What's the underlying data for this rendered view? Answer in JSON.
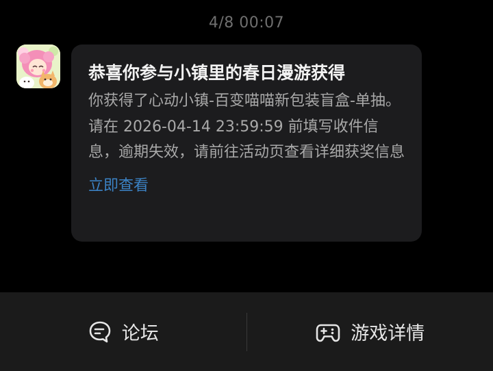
{
  "chat": {
    "timestamp": "4/8  00:07",
    "message": {
      "title": "恭喜你参与小镇里的春日漫游获得",
      "body": "你获得了心动小镇-百变喵喵新包装盲盒-单抽。请在 2026-04-14 23:59:59 前填写收件信息，逾期失效，请前往活动页查看详细获奖信息",
      "link_label": "立即查看"
    },
    "avatar_icon": "heartopia-game-icon"
  },
  "bottom_bar": {
    "forum": {
      "label": "论坛",
      "icon": "forum-chat-icon"
    },
    "game_details": {
      "label": "游戏详情",
      "icon": "gamepad-icon"
    }
  },
  "colors": {
    "background": "#000000",
    "bubble": "#1c1c1e",
    "link": "#3b82c4",
    "bar": "#1b1b1b"
  }
}
